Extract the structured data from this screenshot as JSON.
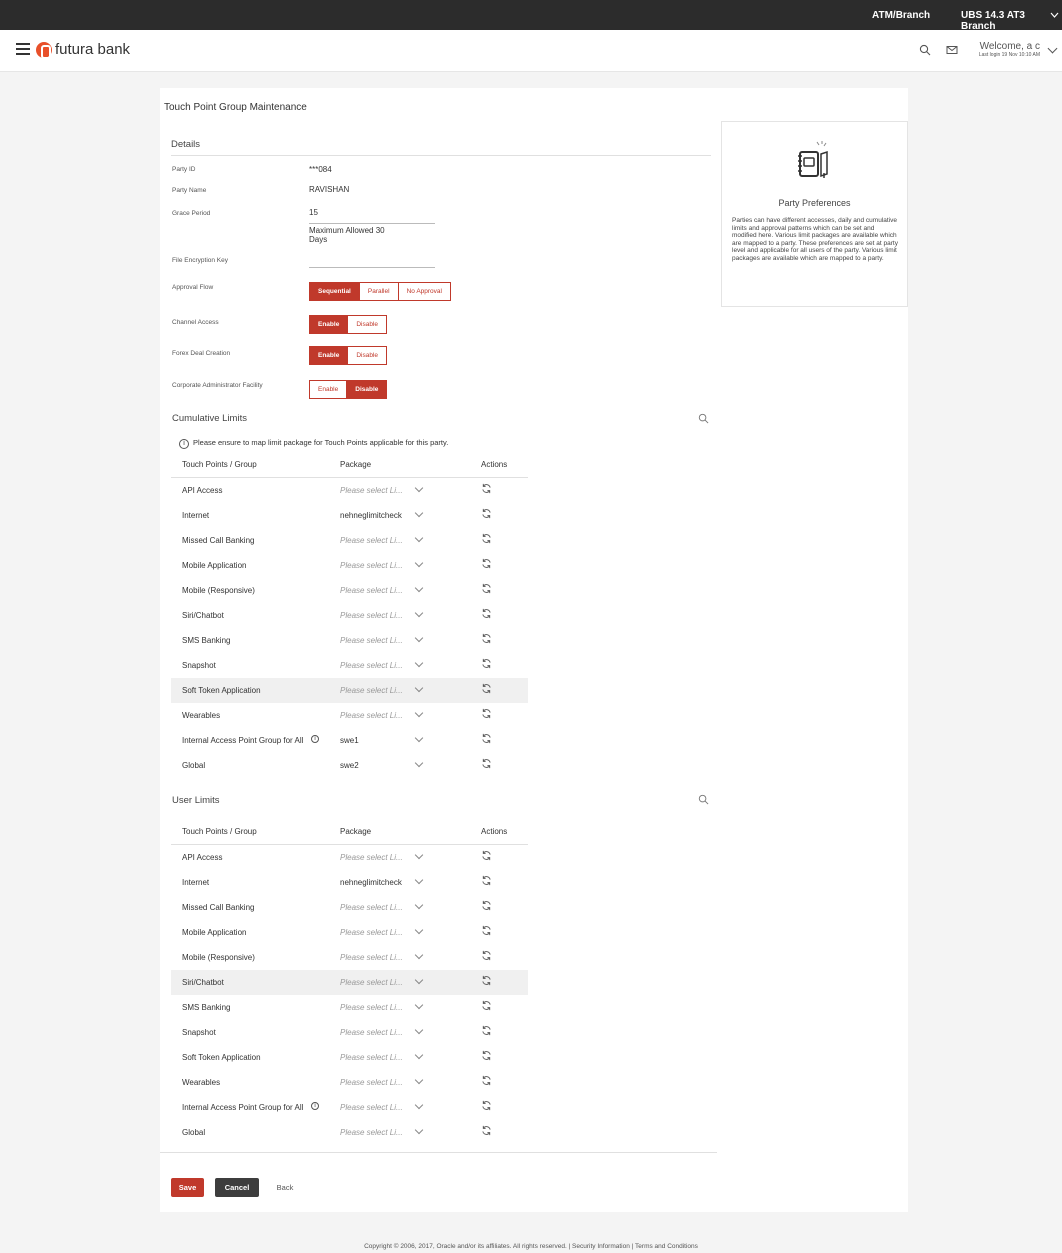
{
  "topbar": {
    "location": "ATM/Branch",
    "branch": "UBS 14.3 AT3 Branch"
  },
  "header": {
    "brand": "futura bank",
    "welcome": "Welcome, a c",
    "last_login": "Last login 19 Nov 10:10 AM"
  },
  "page": {
    "title": "Touch Point Group Maintenance"
  },
  "details": {
    "title": "Details",
    "party_id_label": "Party ID",
    "party_id": "***084",
    "party_name_label": "Party Name",
    "party_name": "RAVISHAN",
    "grace_period_label": "Grace Period",
    "grace_period": "15",
    "grace_hint": "Maximum Allowed 30 Days",
    "file_key_label": "File Encryption Key",
    "approval_flow_label": "Approval Flow",
    "approval_options": [
      "Sequential",
      "Parallel",
      "No Approval"
    ],
    "approval_selected": "Sequential",
    "channel_access_label": "Channel Access",
    "forex_label": "Forex Deal Creation",
    "corp_admin_label": "Corporate Administrator Facility",
    "toggle_options": [
      "Enable",
      "Disable"
    ],
    "channel_access": "Enable",
    "forex": "Enable",
    "corp_admin": "Disable"
  },
  "cumulative": {
    "title": "Cumulative Limits",
    "note": "Please ensure to map limit package for Touch Points applicable for this party.",
    "col_tp": "Touch Points / Group",
    "col_pkg": "Package",
    "col_act": "Actions",
    "rows": [
      {
        "tp": "API Access",
        "pkg": "Please select Li..."
      },
      {
        "tp": "Internet",
        "pkg": "nehneglimitcheck"
      },
      {
        "tp": "Missed Call Banking",
        "pkg": "Please select Li..."
      },
      {
        "tp": "Mobile Application",
        "pkg": "Please select Li..."
      },
      {
        "tp": "Mobile (Responsive)",
        "pkg": "Please select Li..."
      },
      {
        "tp": "Siri/Chatbot",
        "pkg": "Please select Li..."
      },
      {
        "tp": "SMS Banking",
        "pkg": "Please select Li..."
      },
      {
        "tp": "Snapshot",
        "pkg": "Please select Li..."
      },
      {
        "tp": "Soft Token Application",
        "pkg": "Please select Li..."
      },
      {
        "tp": "Wearables",
        "pkg": "Please select Li..."
      },
      {
        "tp": "Internal Access Point Group for All",
        "pkg": "swe1"
      },
      {
        "tp": "Global",
        "pkg": "swe2"
      }
    ]
  },
  "user": {
    "title": "User Limits",
    "col_tp": "Touch Points / Group",
    "col_pkg": "Package",
    "col_act": "Actions",
    "rows": [
      {
        "tp": "API Access",
        "pkg": "Please select Li..."
      },
      {
        "tp": "Internet",
        "pkg": "nehneglimitcheck"
      },
      {
        "tp": "Missed Call Banking",
        "pkg": "Please select Li..."
      },
      {
        "tp": "Mobile Application",
        "pkg": "Please select Li..."
      },
      {
        "tp": "Mobile (Responsive)",
        "pkg": "Please select Li..."
      },
      {
        "tp": "Siri/Chatbot",
        "pkg": "Please select Li..."
      },
      {
        "tp": "SMS Banking",
        "pkg": "Please select Li..."
      },
      {
        "tp": "Snapshot",
        "pkg": "Please select Li..."
      },
      {
        "tp": "Soft Token Application",
        "pkg": "Please select Li..."
      },
      {
        "tp": "Wearables",
        "pkg": "Please select Li..."
      },
      {
        "tp": "Internal Access Point Group for All",
        "pkg": "Please select Li..."
      },
      {
        "tp": "Global",
        "pkg": "Please select Li..."
      }
    ]
  },
  "sidebar": {
    "title": "Party Preferences",
    "text": "Parties can have different accesses, daily and cumulative limits and approval patterns which can be set and modified here. Various limit packages are available which are mapped to a party. These preferences are set at party level and applicable for all users of the party. Various limit packages are available which are mapped to a party."
  },
  "actions": {
    "save": "Save",
    "cancel": "Cancel",
    "back": "Back"
  },
  "footer": {
    "text": "Copyright © 2006, 2017, Oracle and/or its affiliates. All rights reserved. | Security Information | Terms and Conditions"
  },
  "colors": {
    "accent": "#c0392b",
    "topbar": "#2c2c2c",
    "cancel": "#3d3d3d"
  },
  "icons": {
    "menu": "hamburger-icon",
    "search": "search-icon",
    "mail": "mail-icon",
    "refresh": "refresh-icon",
    "info": "info-icon",
    "notebook": "notebook-icon"
  }
}
